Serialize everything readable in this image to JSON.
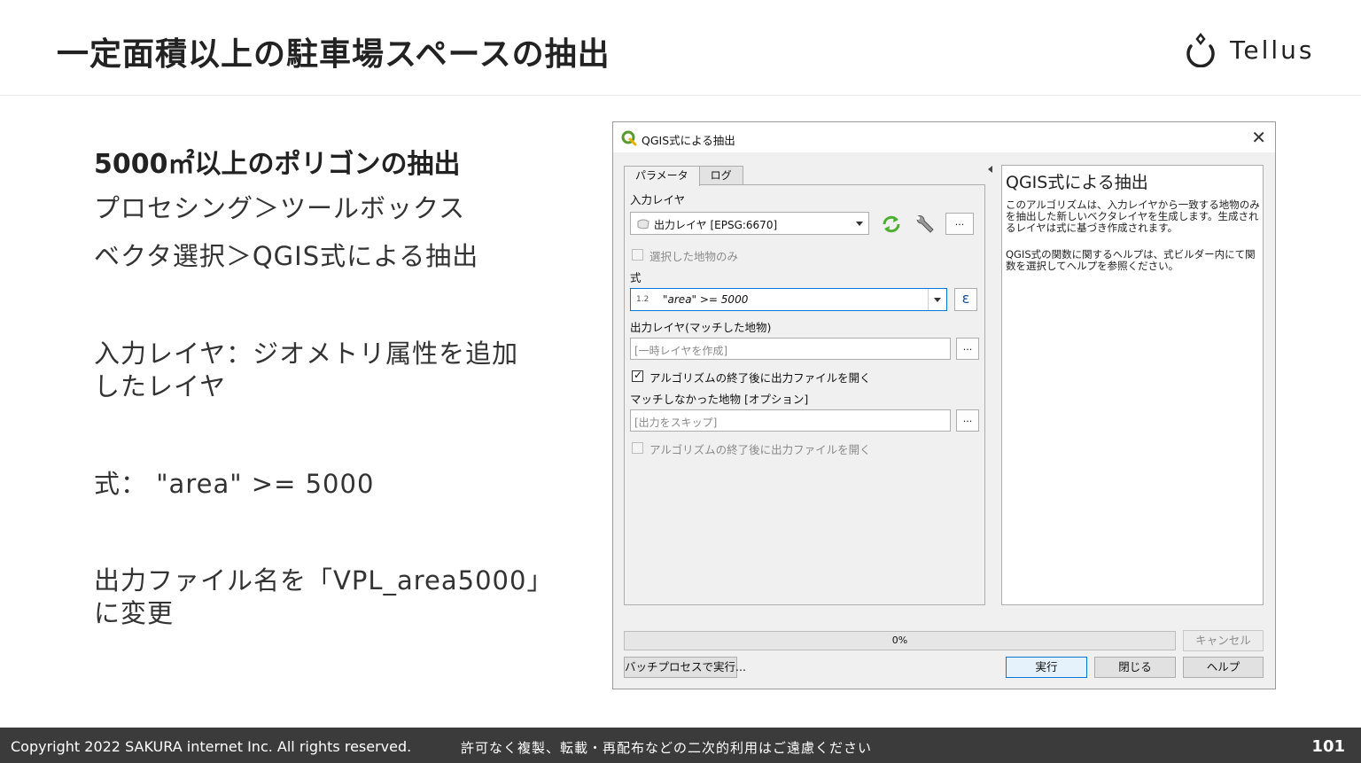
{
  "slide": {
    "title": "一定面積以上の駐車場スペースの抽出",
    "logo_text": "Tellus"
  },
  "left": {
    "subhead": "5000㎡以上のポリゴンの抽出",
    "line1": "プロセシング＞ツールボックス",
    "line2": "ベクタ選択＞QGIS式による抽出",
    "line3a": "入力レイヤ：ジオメトリ属性を追加",
    "line3b": "したレイヤ",
    "line4": "式：  \"area\"  >= 5000",
    "line5a": "出力ファイル名を「VPL_area5000」",
    "line5b": "に変更"
  },
  "dialog": {
    "title": "QGIS式による抽出",
    "close": "✕",
    "tabs": [
      "パラメータ",
      "ログ"
    ],
    "input_layer_label": "入力レイヤ",
    "input_layer_value": "出力レイヤ [EPSG:6670]",
    "selected_only_label": "選択した地物のみ",
    "expression_label": "式",
    "expression_prefix": "1.2",
    "expression_value": "\"area\" >= 5000",
    "epsilon": "ε",
    "output_label": "出力レイヤ(マッチした地物)",
    "output_placeholder": "[一時レイヤを作成]",
    "open_after_label": "アルゴリズムの終了後に出力ファイルを開く",
    "unmatched_label": "マッチしなかった地物 [オプション]",
    "unmatched_placeholder": "[出力をスキップ]",
    "open_after_label2": "アルゴリズムの終了後に出力ファイルを開く",
    "dots": "...",
    "help_title": "QGIS式による抽出",
    "help_p1": "このアルゴリズムは、入力レイヤから一致する地物のみを抽出した新しいベクタレイヤを生成します。生成されるレイヤは式に基づき作成されます。",
    "help_p2": "QGIS式の関数に関するヘルプは、式ビルダー内にて関数を選択してヘルプを参照ください。",
    "progress": "0%",
    "cancel": "キャンセル",
    "batch": "バッチプロセスで実行...",
    "run": "実行",
    "close_btn": "閉じる",
    "help_btn": "ヘルプ"
  },
  "footer": {
    "copyright": "Copyright 2022 SAKURA internet Inc. All rights reserved.",
    "notice": "許可なく複製、転載・再配布などの二次的利用はご遠慮ください",
    "page": "101"
  }
}
